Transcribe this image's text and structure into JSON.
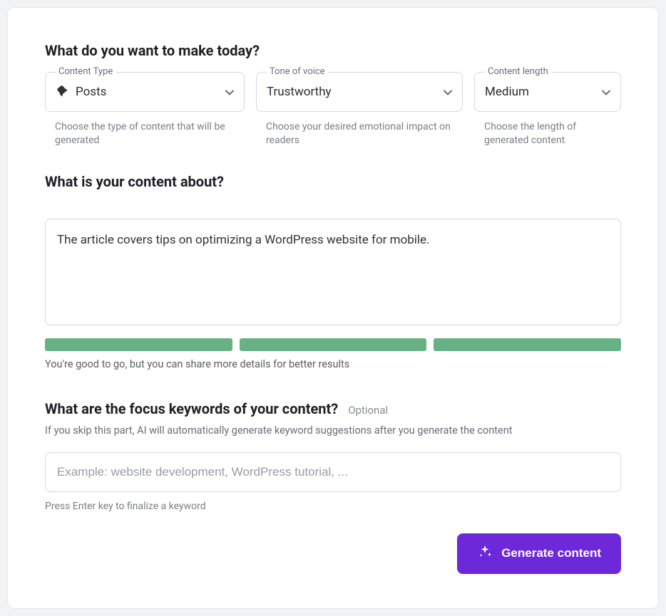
{
  "section1": {
    "heading": "What do you want to make today?",
    "contentType": {
      "label": "Content Type",
      "value": "Posts",
      "helper": "Choose the type of content that will be generated"
    },
    "tone": {
      "label": "Tone of voice",
      "value": "Trustworthy",
      "helper": "Choose your desired emotional impact on readers"
    },
    "length": {
      "label": "Content length",
      "value": "Medium",
      "helper": "Choose the length of generated content"
    }
  },
  "section2": {
    "heading": "What is your content about?",
    "value": "The article covers tips on optimizing a WordPress website for mobile.",
    "progressText": "You're good to go, but you can share more details for better results"
  },
  "section3": {
    "heading": "What are the focus keywords of your content?",
    "optional": "Optional",
    "sub": "If you skip this part, AI will automatically generate keyword suggestions after you generate the content",
    "placeholder": "Example: website development, WordPress tutorial, ...",
    "hint": "Press Enter key to finalize a keyword"
  },
  "action": {
    "generate": "Generate content"
  }
}
